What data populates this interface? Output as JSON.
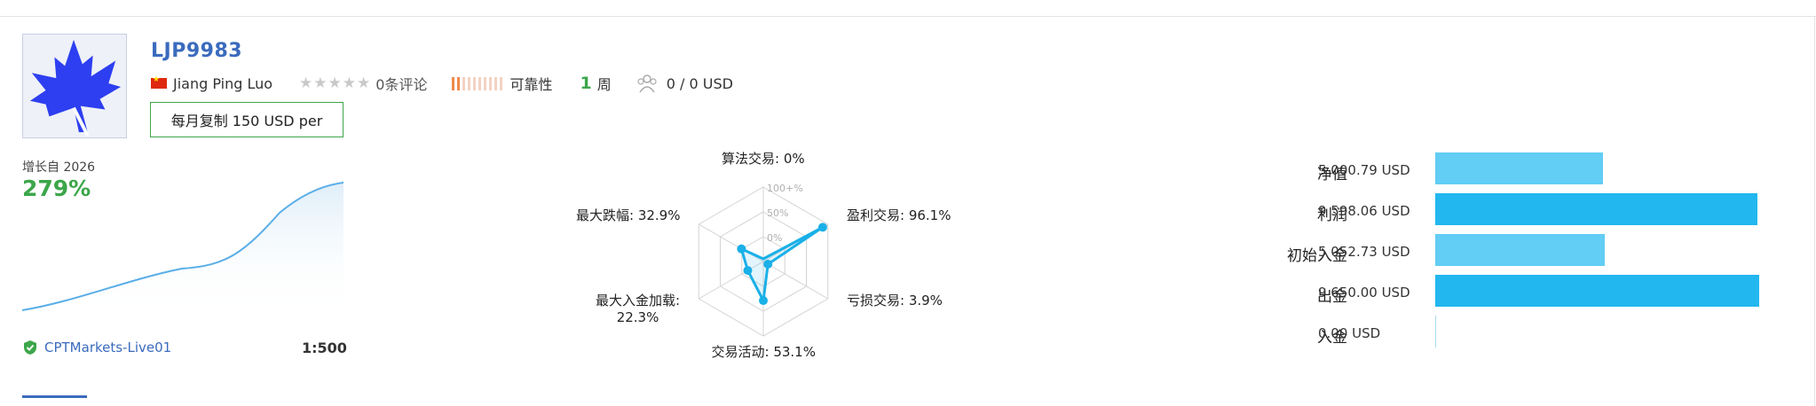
{
  "signal": {
    "name": "LJP9983",
    "author": "Jiang Ping Luo",
    "reviews_label": "0条评论",
    "reliability_label": "可靠性",
    "reliability_level": 2,
    "reliability_max": 10,
    "weeks_value": "1",
    "weeks_label": "周",
    "subscribers_value": "0 / 0 USD",
    "copy_button_label": "每月复制 150 USD per"
  },
  "growth": {
    "label": "增长自 2026",
    "value": "279%",
    "color": "#5aaee8"
  },
  "account": {
    "server": "CPTMarkets-Live01",
    "leverage": "1:500"
  },
  "radar": {
    "scale_labels": [
      "100+%",
      "50%",
      "0%"
    ],
    "axes": [
      {
        "label": "算法交易: 0%",
        "value": 0
      },
      {
        "label": "盈利交易: 96.1%",
        "value": 96.1
      },
      {
        "label": "亏损交易: 3.9%",
        "value": 3.9
      },
      {
        "label": "交易活动: 53.1%",
        "value": 53.1
      },
      {
        "label": "最大入金加载:",
        "label2": "22.3%",
        "value": 22.3
      },
      {
        "label": "最大跌幅: 32.9%",
        "value": 32.9
      }
    ],
    "color": "#1ab0e8"
  },
  "stats": [
    {
      "label": "净值",
      "value": "5 000.79 USD",
      "amount": 5000.79,
      "color": "#62cdf5"
    },
    {
      "label": "利润",
      "value": "9 598.06 USD",
      "amount": 9598.06,
      "color": "#22b7ee"
    },
    {
      "label": "初始入金",
      "value": "5 052.73 USD",
      "amount": 5052.73,
      "color": "#62cdf5"
    },
    {
      "label": "出金",
      "value": "9 650.00 USD",
      "amount": 9650.0,
      "color": "#22b7ee"
    },
    {
      "label": "入金",
      "value": "0.00 USD",
      "amount": 0,
      "color": "#62cdf5"
    }
  ]
}
